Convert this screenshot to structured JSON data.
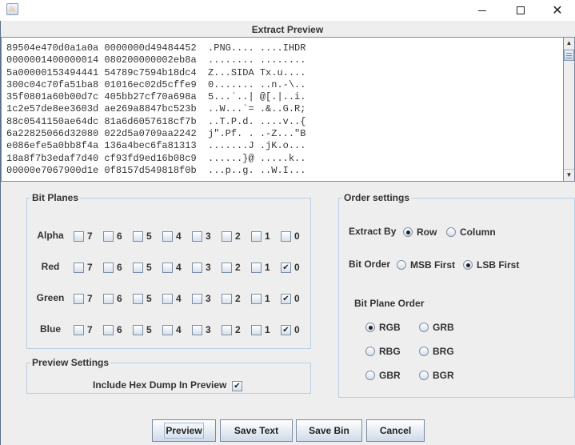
{
  "window": {
    "icon": "java-app-icon",
    "controls": {
      "minimize": "minimize",
      "maximize": "maximize",
      "close": "close"
    }
  },
  "preview": {
    "title": "Extract Preview",
    "lines": [
      "89504e470d0a1a0a 0000000d49484452  .PNG.... ....IHDR",
      "0000001400000014 080200000002eb8a  ........ ........",
      "5a00000153494441 54789c7594b18dc4  Z...SIDA Tx.u....",
      "300c04c70fa51ba8 01016ec02d5cffe9  0....... ..n.-\\..",
      "35f0801a60b00d7c 405bb27cf70a698a  5...`..| @[.|..i.",
      "1c2e57de8ee3603d ae269a8847bc523b  ..W...`= .&..G.R;",
      "88c0541150ae64dc 81a6d6057618cf7b  ..T.P.d. ....v..{",
      "6a22825066d32080 022d5a0709aa2242  j\".Pf. . .-Z...\"B",
      "e086efe5a0bb8f4a 136a4bec6fa81313  .......J .jK.o...",
      "18a8f7b3edaf7d40 cf93fd9ed16b08c9  ......}@ .....k..",
      "00000e7067900d1e 0f8157d549818f0b  ...p..g. ..W.I..."
    ]
  },
  "bit_planes": {
    "legend": "Bit Planes",
    "rows": [
      {
        "label": "Alpha",
        "bits": [
          {
            "n": "7",
            "checked": false
          },
          {
            "n": "6",
            "checked": false
          },
          {
            "n": "5",
            "checked": false
          },
          {
            "n": "4",
            "checked": false
          },
          {
            "n": "3",
            "checked": false
          },
          {
            "n": "2",
            "checked": false
          },
          {
            "n": "1",
            "checked": false
          },
          {
            "n": "0",
            "checked": false
          }
        ]
      },
      {
        "label": "Red",
        "bits": [
          {
            "n": "7",
            "checked": false
          },
          {
            "n": "6",
            "checked": false
          },
          {
            "n": "5",
            "checked": false
          },
          {
            "n": "4",
            "checked": false
          },
          {
            "n": "3",
            "checked": false
          },
          {
            "n": "2",
            "checked": false
          },
          {
            "n": "1",
            "checked": false
          },
          {
            "n": "0",
            "checked": true
          }
        ]
      },
      {
        "label": "Green",
        "bits": [
          {
            "n": "7",
            "checked": false
          },
          {
            "n": "6",
            "checked": false
          },
          {
            "n": "5",
            "checked": false
          },
          {
            "n": "4",
            "checked": false
          },
          {
            "n": "3",
            "checked": false
          },
          {
            "n": "2",
            "checked": false
          },
          {
            "n": "1",
            "checked": false
          },
          {
            "n": "0",
            "checked": true
          }
        ]
      },
      {
        "label": "Blue",
        "bits": [
          {
            "n": "7",
            "checked": false
          },
          {
            "n": "6",
            "checked": false
          },
          {
            "n": "5",
            "checked": false
          },
          {
            "n": "4",
            "checked": false
          },
          {
            "n": "3",
            "checked": false
          },
          {
            "n": "2",
            "checked": false
          },
          {
            "n": "1",
            "checked": false
          },
          {
            "n": "0",
            "checked": true
          }
        ]
      }
    ]
  },
  "preview_settings": {
    "legend": "Preview Settings",
    "include_hex_label": "Include Hex Dump In Preview",
    "include_hex_checked": true
  },
  "order_settings": {
    "legend": "Order settings",
    "extract_by": {
      "label": "Extract By",
      "options": [
        {
          "label": "Row",
          "selected": true
        },
        {
          "label": "Column",
          "selected": false
        }
      ]
    },
    "bit_order": {
      "label": "Bit Order",
      "options": [
        {
          "label": "MSB First",
          "selected": false
        },
        {
          "label": "LSB First",
          "selected": true
        }
      ]
    },
    "bit_plane_order": {
      "label": "Bit Plane Order",
      "options": [
        {
          "label": "RGB",
          "selected": true
        },
        {
          "label": "GRB",
          "selected": false
        },
        {
          "label": "RBG",
          "selected": false
        },
        {
          "label": "BRG",
          "selected": false
        },
        {
          "label": "GBR",
          "selected": false
        },
        {
          "label": "BGR",
          "selected": false
        }
      ]
    }
  },
  "buttons": {
    "preview": "Preview",
    "save_text": "Save Text",
    "save_bin": "Save Bin",
    "cancel": "Cancel"
  }
}
